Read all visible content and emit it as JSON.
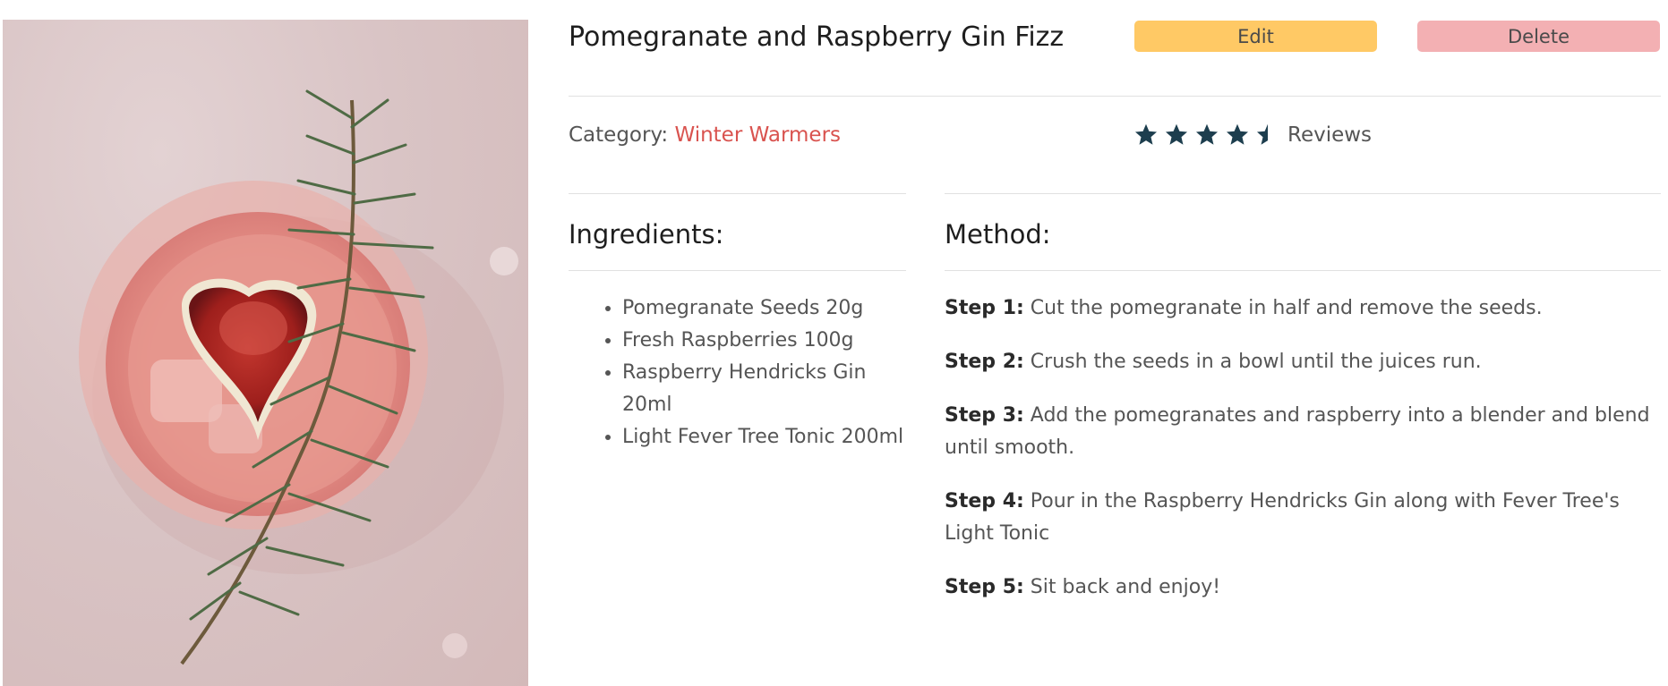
{
  "recipe": {
    "title": "Pomegranate and Raspberry Gin Fizz",
    "image_alt": "Overhead view of a pink gin cocktail garnished with a halved fig and a rosemary sprig"
  },
  "actions": {
    "edit_label": "Edit",
    "delete_label": "Delete"
  },
  "meta": {
    "category_label": "Category:",
    "category_value": "Winter Warmers",
    "rating": 4.5,
    "rating_max": 5,
    "reviews_label": "Reviews"
  },
  "ingredients": {
    "heading": "Ingredients:",
    "items": [
      "Pomegranate Seeds 20g",
      "Fresh Raspberries 100g",
      "Raspberry Hendricks Gin 20ml",
      "Light Fever Tree Tonic 200ml"
    ]
  },
  "method": {
    "heading": "Method:",
    "steps": [
      {
        "label": "Step 1:",
        "text": "Cut the pomegranate in half and remove the seeds."
      },
      {
        "label": "Step 2:",
        "text": "Crush the seeds in a bowl until the juices run."
      },
      {
        "label": "Step 3:",
        "text": "Add the pomegranates and raspberry into a blender and blend until smooth."
      },
      {
        "label": "Step 4:",
        "text": "Pour in the Raspberry Hendricks Gin along with Fever Tree's Light Tonic"
      },
      {
        "label": "Step 5:",
        "text": "Sit back and enjoy!"
      }
    ]
  },
  "colors": {
    "edit_button": "#ffc965",
    "delete_button": "#f3b0b3",
    "category_link": "#d9534f",
    "star": "#1d3e4e"
  }
}
